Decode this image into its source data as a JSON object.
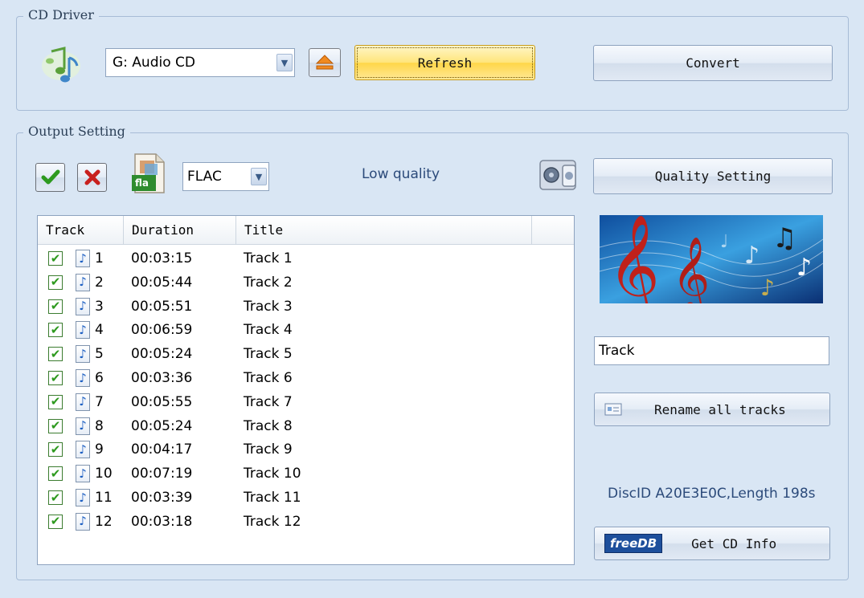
{
  "cd_driver": {
    "legend": "CD Driver",
    "drive_value": "G:  Audio CD",
    "refresh_label": "Refresh",
    "convert_label": "Convert"
  },
  "output": {
    "legend": "Output Setting",
    "format_icon_text": "fla",
    "format_value": "FLAC",
    "quality_text": "Low quality",
    "quality_button_label": "Quality Setting"
  },
  "tracks": {
    "headers": [
      "Track",
      "Duration",
      "Title"
    ],
    "rows": [
      {
        "num": "1",
        "duration": "00:03:15",
        "title": "Track 1"
      },
      {
        "num": "2",
        "duration": "00:05:44",
        "title": "Track 2"
      },
      {
        "num": "3",
        "duration": "00:05:51",
        "title": "Track 3"
      },
      {
        "num": "4",
        "duration": "00:06:59",
        "title": "Track 4"
      },
      {
        "num": "5",
        "duration": "00:05:24",
        "title": "Track 5"
      },
      {
        "num": "6",
        "duration": "00:03:36",
        "title": "Track 6"
      },
      {
        "num": "7",
        "duration": "00:05:55",
        "title": "Track 7"
      },
      {
        "num": "8",
        "duration": "00:05:24",
        "title": "Track 8"
      },
      {
        "num": "9",
        "duration": "00:04:17",
        "title": "Track 9"
      },
      {
        "num": "10",
        "duration": "00:07:19",
        "title": "Track 10"
      },
      {
        "num": "11",
        "duration": "00:03:39",
        "title": "Track 11"
      },
      {
        "num": "12",
        "duration": "00:03:18",
        "title": "Track 12"
      }
    ]
  },
  "rename": {
    "prefix_value": "Track",
    "button_label": "Rename all tracks"
  },
  "disc": {
    "info_text": "DiscID A20E3E0C,Length 198s",
    "freedb_logo_text": "freeDB",
    "get_info_label": "Get CD Info"
  },
  "icons": {
    "check": "check-icon",
    "cross": "cross-icon",
    "eject": "eject-icon",
    "music_note": "music-note-icon"
  },
  "colors": {
    "background": "#d9e6f4",
    "refresh_button": "#ffd648",
    "accent_text": "#2b4a7a",
    "check_green": "#2e9a1f",
    "cross_red": "#c8201e"
  }
}
